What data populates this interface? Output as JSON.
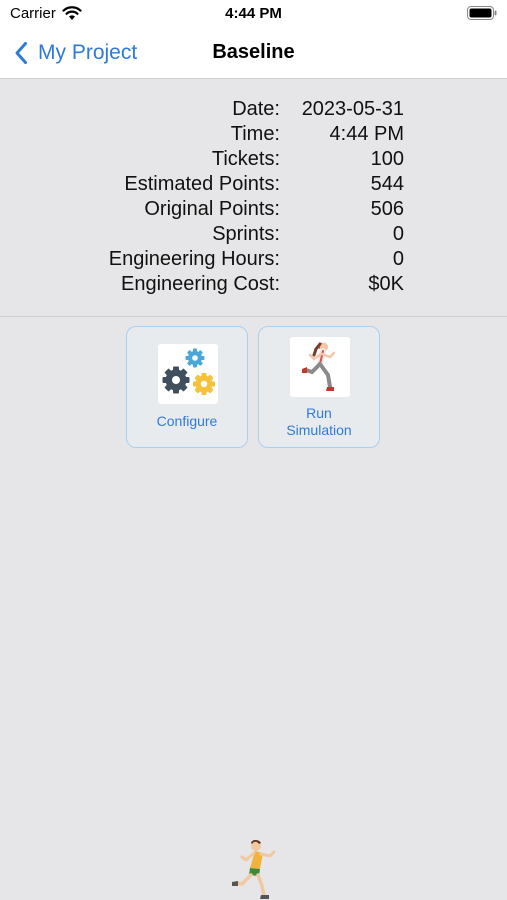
{
  "status_bar": {
    "carrier": "Carrier",
    "time": "4:44 PM"
  },
  "nav": {
    "back_label": "My Project",
    "title": "Baseline"
  },
  "summary": [
    {
      "label": "Date:",
      "value": "2023-05-31"
    },
    {
      "label": "Time:",
      "value": "4:44 PM"
    },
    {
      "label": "Tickets:",
      "value": "100"
    },
    {
      "label": "Estimated Points:",
      "value": "544"
    },
    {
      "label": "Original Points:",
      "value": "506"
    },
    {
      "label": "Sprints:",
      "value": "0"
    },
    {
      "label": "Engineering Hours:",
      "value": "0"
    },
    {
      "label": "Engineering Cost:",
      "value": "$0K"
    }
  ],
  "actions": {
    "configure": {
      "label": "Configure",
      "icon": "gears-icon"
    },
    "run_simulation": {
      "line1": "Run",
      "line2": "Simulation",
      "icon": "runner-icon"
    }
  },
  "colors": {
    "accent": "#2f7ad8",
    "background": "#e6e6e8",
    "tile_border": "#a8d0f2"
  }
}
